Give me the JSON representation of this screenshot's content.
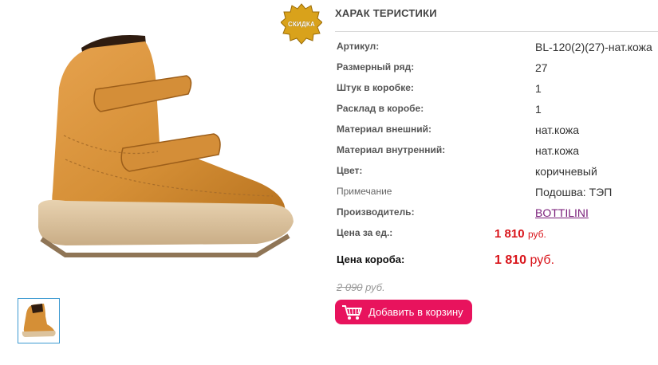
{
  "badge": {
    "text": "СКИДКА"
  },
  "specs": {
    "title": "ХАРАК ТЕРИСТИКИ",
    "rows": [
      {
        "label": "Артикул:",
        "value": "BL-120(2)(27)-нат.кожа"
      },
      {
        "label": "Размерный ряд:",
        "value": "27"
      },
      {
        "label": "Штук в коробке:",
        "value": "1"
      },
      {
        "label": "Расклад в коробе:",
        "value": "1"
      },
      {
        "label": "Материал внешний:",
        "value": "нат.кожа"
      },
      {
        "label": "Материал внутренний:",
        "value": "нат.кожа"
      },
      {
        "label": "Цвет:",
        "value": "коричневый"
      },
      {
        "label": "Примечание",
        "value": "Подошва: ТЭП"
      },
      {
        "label": "Производитель:",
        "value": "BOTTILINI"
      }
    ]
  },
  "prices": {
    "unit": {
      "label": "Цена за ед.:",
      "amount": "1 810",
      "currency": "руб."
    },
    "box": {
      "label": "Цена короба:",
      "amount": "1 810",
      "currency": "руб."
    },
    "old": {
      "amount": "2 090",
      "currency": "руб."
    }
  },
  "cart_button": {
    "label": "Добавить в корзину"
  },
  "colors": {
    "price": "#d9141a",
    "cart_button": "#e8135d",
    "link": "#7a1f7a"
  }
}
